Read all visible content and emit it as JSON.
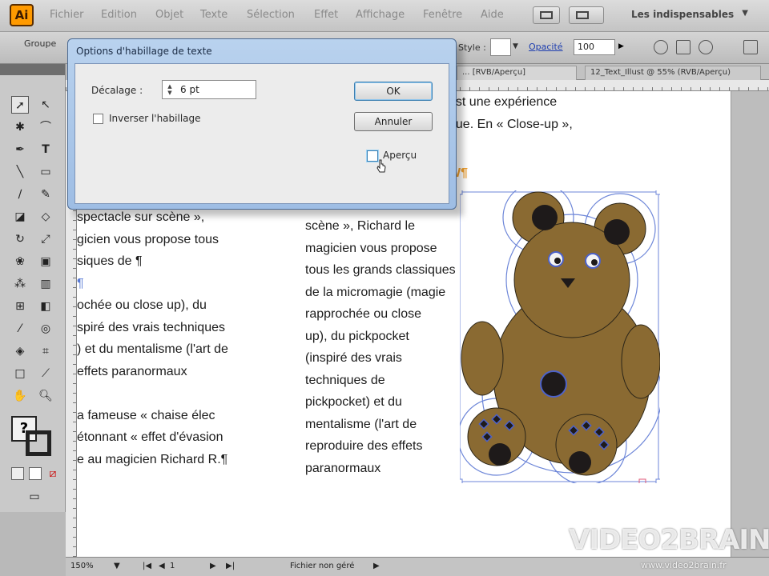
{
  "menubar": {
    "logo": "Ai",
    "items": [
      "Fichier",
      "Edition",
      "Objet",
      "Texte",
      "Sélection",
      "Effet",
      "Affichage",
      "Fenêtre",
      "Aide"
    ],
    "workspace": "Les indispensables"
  },
  "controlbar": {
    "group_label": "Groupe",
    "style_label": "Style :",
    "opacity_label": "Opacité",
    "opacity_value": "100"
  },
  "tabs": [
    {
      "label": "... [RVB/Aperçu]"
    },
    {
      "label": "12_Text_Illust @ 55% (RVB/Aperçu)"
    }
  ],
  "dialog": {
    "title": "Options d'habillage de texte",
    "offset_label": "Décalage :",
    "offset_value": "6 pt",
    "invert_label": "Inverser l'habillage",
    "ok_label": "OK",
    "cancel_label": "Annuler",
    "preview_label": "Aperçu"
  },
  "document": {
    "top_lines": [
      "est une expérience",
      "que. En « Close-up »,"
    ],
    "heading_fragment": "W¶",
    "left_column": [
      "spectacle sur scène »,",
      "gicien vous propose tous",
      "siques de ¶",
      "¶",
      "ochée ou close up), du",
      "spiré des vrais techniques",
      ") et du mentalisme (l'art de",
      "effets paranormaux",
      "",
      "a fameuse « chaise élec",
      "étonnant « effet d'évasion",
      "e au magicien Richard R.¶"
    ],
    "right_column": [
      "scène », Richard le",
      "magicien vous propose",
      "tous les grands classiques",
      "de la micromagie (magie",
      "rapprochée ou close",
      "up), du pickpocket",
      "(inspiré des vrais",
      "techniques de",
      "pickpocket) et du",
      "mentalisme (l'art de",
      "reproduire des effets",
      "paranormaux"
    ]
  },
  "statusbar": {
    "zoom": "150%",
    "page": "1",
    "status": "Fichier non géré"
  },
  "watermark": {
    "brand": "VIDEO2BRAIN",
    "url": "www.video2brain.fr"
  },
  "colors": {
    "bear_fill": "#8a6a32",
    "bear_dark": "#1e1a1a",
    "selection": "#6d86d8",
    "heading_orange": "#f0a030"
  }
}
